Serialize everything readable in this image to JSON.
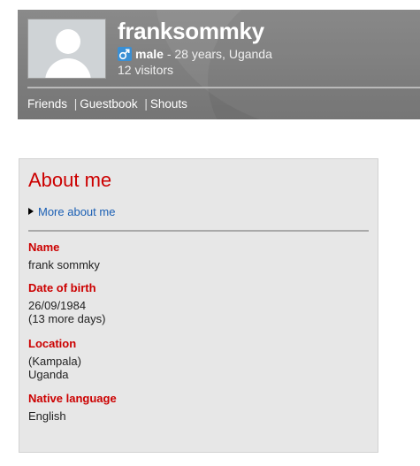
{
  "profile": {
    "username": "franksommky",
    "gender": "male",
    "age_location": "- 28 years, Uganda",
    "visitors": "12 visitors",
    "gender_icon": "male-symbol-icon",
    "gender_icon_color": "#3a8fd4"
  },
  "nav": {
    "friends": "Friends",
    "guestbook": "Guestbook",
    "shouts": "Shouts",
    "separator": "|"
  },
  "about": {
    "title": "About me",
    "more_link": "More about me",
    "fields": [
      {
        "label": "Name",
        "lines": [
          "frank sommky"
        ]
      },
      {
        "label": "Date of birth",
        "lines": [
          "26/09/1984",
          "(13 more days)"
        ]
      },
      {
        "label": "Location",
        "lines": [
          "(Kampala)",
          "Uganda"
        ]
      },
      {
        "label": "Native language",
        "lines": [
          "English"
        ]
      }
    ]
  },
  "colors": {
    "header_bg": "#808080",
    "accent_red": "#cc0000",
    "link_blue": "#1a5fb4",
    "card_bg": "#e7e7e7"
  }
}
